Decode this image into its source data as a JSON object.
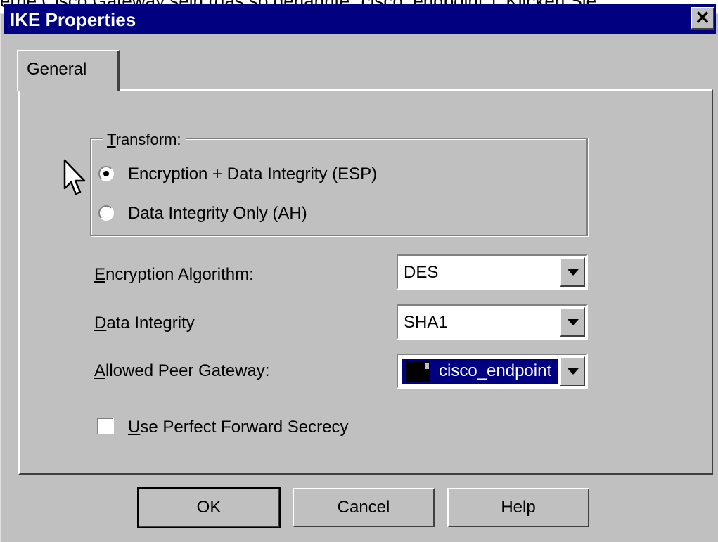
{
  "context_text": "erne Cisco Gateway sein (das so genannte \"cisco_endpoint\"). Klicken Sie",
  "window": {
    "title": "IKE Properties",
    "close_glyph": "✕"
  },
  "tabs": [
    {
      "label": "General",
      "selected": true
    }
  ],
  "transform": {
    "legend": "Transform:",
    "legend_mnemonic": "T",
    "options": [
      {
        "label": "Encryption + Data Integrity (ESP)",
        "checked": true
      },
      {
        "label": "Data Integrity Only (AH)",
        "checked": false
      }
    ]
  },
  "fields": {
    "encryption_algorithm": {
      "label": "Encryption Algorithm:",
      "mnemonic": "E",
      "value": "DES"
    },
    "data_integrity": {
      "label": "Data Integrity",
      "mnemonic": "D",
      "value": "SHA1"
    },
    "allowed_peer_gateway": {
      "label": "Allowed Peer Gateway:",
      "mnemonic": "A",
      "value": "cisco_endpoint",
      "icon": "gateway-icon"
    }
  },
  "pfs": {
    "label": "Use Perfect Forward Secrecy",
    "mnemonic": "U",
    "checked": false
  },
  "buttons": {
    "ok": "OK",
    "cancel": "Cancel",
    "help": "Help"
  },
  "colors": {
    "titlebar": "#000080",
    "face": "#c0c0c0",
    "selection": "#000080"
  }
}
